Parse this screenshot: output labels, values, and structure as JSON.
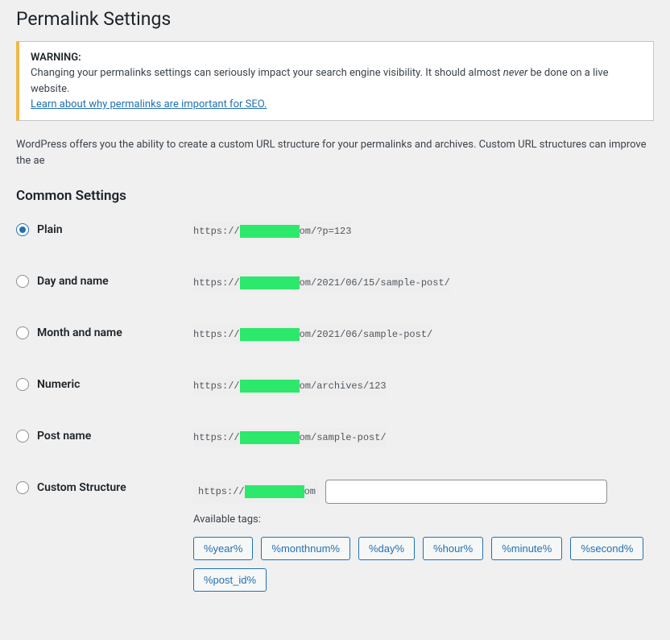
{
  "page_title": "Permalink Settings",
  "notice": {
    "warning_label": "WARNING:",
    "text_before": "Changing your permalinks settings can seriously impact your search engine visibility. It should almost ",
    "text_italic": "never",
    "text_after": " be done on a live website.",
    "link": "Learn about why permalinks are important for SEO."
  },
  "description": "WordPress offers you the ability to create a custom URL structure for your permalinks and archives. Custom URL structures can improve the ae",
  "section_heading": "Common Settings",
  "options": {
    "plain": {
      "label": "Plain",
      "url_prefix": "https://",
      "url_suffix": "om/?p=123"
    },
    "day_name": {
      "label": "Day and name",
      "url_prefix": "https://",
      "url_suffix": "om/2021/06/15/sample-post/"
    },
    "month_name": {
      "label": "Month and name",
      "url_prefix": "https://",
      "url_suffix": "om/2021/06/sample-post/"
    },
    "numeric": {
      "label": "Numeric",
      "url_prefix": "https://",
      "url_suffix": "om/archives/123"
    },
    "post_name": {
      "label": "Post name",
      "url_prefix": "https://",
      "url_suffix": "om/sample-post/"
    },
    "custom": {
      "label": "Custom Structure",
      "url_prefix": "https://",
      "url_suffix": "om",
      "input_value": "",
      "tags_label": "Available tags:",
      "tags": [
        "%year%",
        "%monthnum%",
        "%day%",
        "%hour%",
        "%minute%",
        "%second%",
        "%post_id%"
      ]
    }
  },
  "selected_option": "plain"
}
